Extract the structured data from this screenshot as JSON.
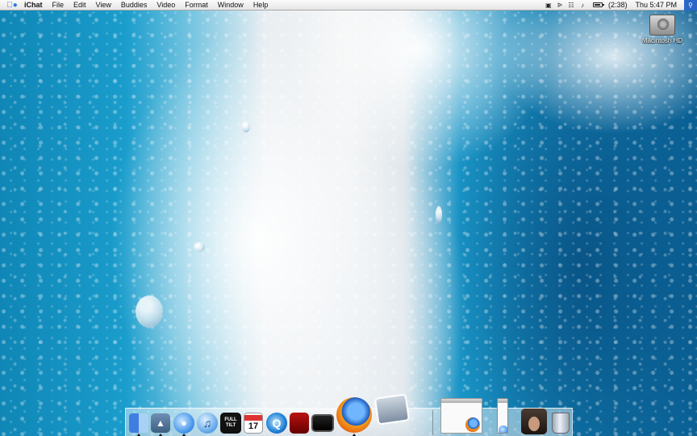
{
  "menubar": {
    "app_name": "iChat",
    "items": [
      "File",
      "Edit",
      "View",
      "Buddies",
      "Video",
      "Format",
      "Window",
      "Help"
    ],
    "battery_text": "(2:38)",
    "clock": "Thu 5:47 PM"
  },
  "desktop": {
    "drive_label": "Macintosh HD"
  },
  "dock": {
    "ical_day": "17",
    "fulltilt_text": "FULL TILT",
    "apps": [
      "Finder",
      "Preview",
      "iChat",
      "iTunes",
      "Full Tilt Poker",
      "iCal",
      "QuickTime Player",
      "Photo Booth",
      "DVD Player",
      "Firefox",
      "iPhoto"
    ],
    "minimized": [
      "Firefox window",
      "Buddy List window",
      "Video chat window"
    ],
    "trash": "Trash"
  },
  "colors": {
    "menubar": "#f0f0f0",
    "spotlight": "#2a66c9",
    "wallpaper_blue": "#1a9dcc"
  }
}
